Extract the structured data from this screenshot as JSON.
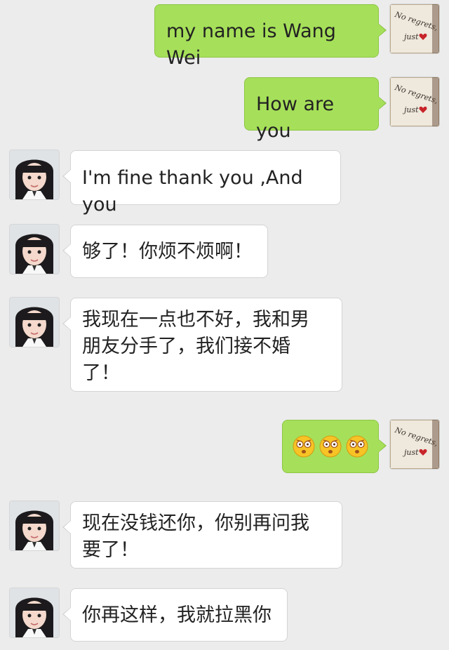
{
  "messages": [
    {
      "side": "out",
      "text": "my name is Wang Wei"
    },
    {
      "side": "out",
      "text": "How are you"
    },
    {
      "side": "in",
      "text": "I'm fine thank you ,And you"
    },
    {
      "side": "in",
      "text": "够了！你烦不烦啊！"
    },
    {
      "side": "in",
      "text": "我现在一点也不好，我和男朋友分手了，我们接不婚了！"
    },
    {
      "side": "out",
      "emoji": [
        "surprised-face",
        "surprised-face",
        "surprised-face"
      ]
    },
    {
      "side": "in",
      "text": "现在没钱还你，你别再问我要了！"
    },
    {
      "side": "in",
      "text": "你再这样，我就拉黑你"
    }
  ],
  "self_avatar": {
    "caption_line1": "No regrets,",
    "caption_line2": "just"
  },
  "colors": {
    "outgoing_bubble": "#a6e05a",
    "incoming_bubble": "#ffffff",
    "background": "#ececec"
  }
}
